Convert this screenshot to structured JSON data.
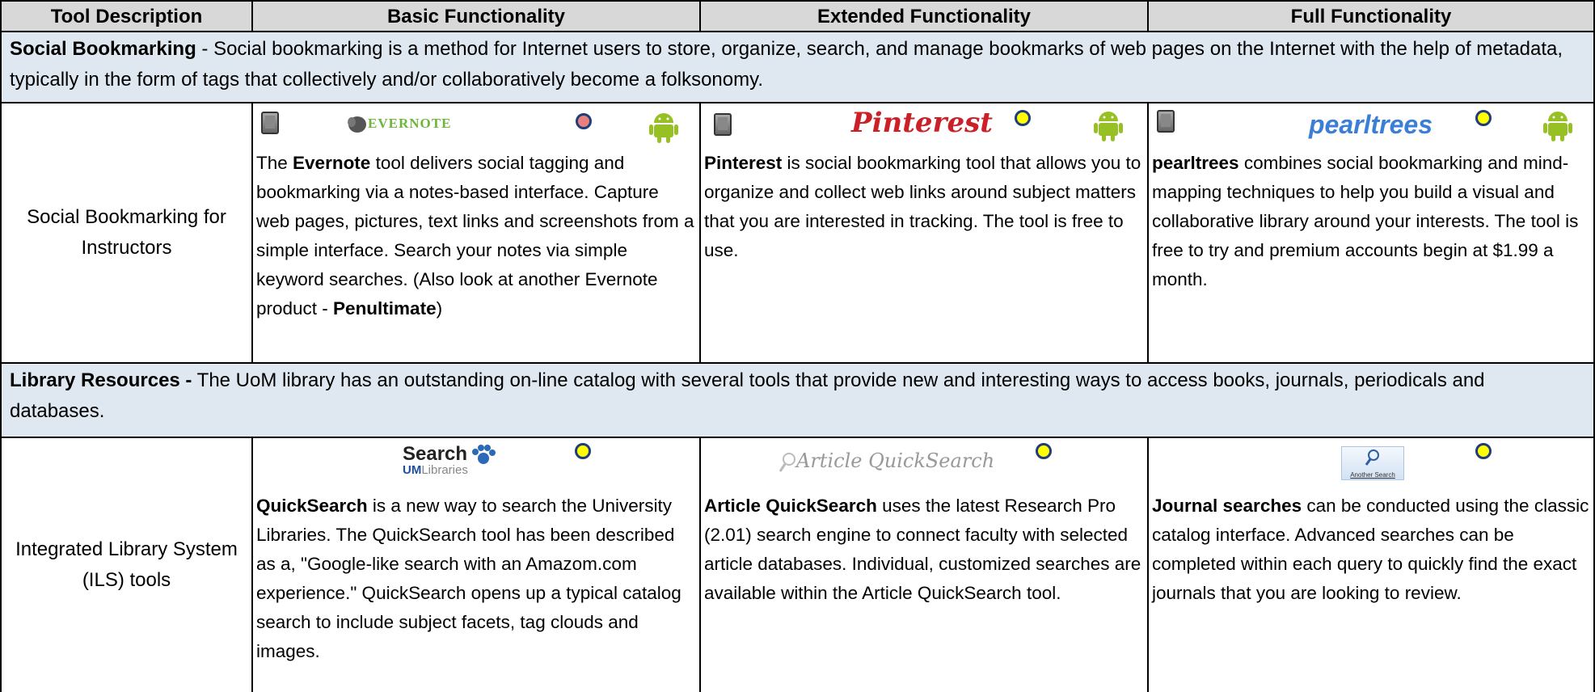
{
  "header": {
    "col1": "Tool Description",
    "col2": "Basic Functionality",
    "col3": "Extended Functionality",
    "col4": "Full Functionality"
  },
  "section1": {
    "title": "Social Bookmarking",
    "text": " - Social bookmarking is a method for Internet users to store, organize, search, and manage bookmarks of web pages on the Internet with the help of metadata, typically in the form of tags that collectively and/or collaboratively become a folksonomy."
  },
  "row1": {
    "label": "Social Bookmarking for Instructors",
    "basic": {
      "logo": "EVERNOTE",
      "pre": "The ",
      "name": "Evernote",
      "body": " tool delivers social tagging and bookmarking via a notes-based interface. Capture web pages, pictures, text links and screenshots from a simple interface.  Search your notes via simple keyword searches. (Also look at another Evernote product - ",
      "product": "Penultimate",
      "post": ")"
    },
    "extended": {
      "logo": "Pinterest",
      "name": "Pinterest",
      "body": " is social bookmarking tool that allows you to organize and collect web links around subject matters that you are interested in tracking.  The tool is free to use."
    },
    "full": {
      "logo": "pearltrees",
      "name": "pearltrees",
      "body": " combines social bookmarking and mind-mapping techniques to help you build a visual and collaborative library around your interests. The tool is free to try and premium accounts begin at $1.99 a month."
    }
  },
  "section2": {
    "title": "Library Resources -",
    "text": " The UoM library has an outstanding  on-line catalog with several tools that provide new and interesting ways to access books, journals, periodicals and databases."
  },
  "row2": {
    "label": "Integrated Library System (ILS) tools",
    "basic": {
      "logo_main": "Search",
      "logo_sub1": "UM",
      "logo_sub2": "Libraries",
      "name": "QuickSearch",
      "body": " is a new way to search the University Libraries.  The QuickSearch tool has been described as a, \"Google-like search with an Amazom.com experience.\" QuickSearch opens up a typical catalog search to include subject facets, tag clouds and images."
    },
    "extended": {
      "logo": "Article QuickSearch",
      "name": "Article QuickSearch",
      "body": " uses the latest Research Pro (2.01) search engine to connect faculty with selected article databases.  Individual, customized searches are available within the Article QuickSearch tool."
    },
    "full": {
      "logo": "Another Search",
      "name": "Journal searches",
      "body": " can be conducted using the classic catalog interface.  Advanced searches can be completed within each query to quickly find the exact journals that you are looking to review."
    }
  },
  "colors": {
    "header_bg": "#d8d8d8",
    "band_bg": "#dfe8f1",
    "dot_yellow": "#ffff00",
    "dot_pink": "#e88080",
    "dot_border": "#1f3d7a",
    "pinterest": "#cb2027",
    "pearltrees": "#3a7fd5"
  },
  "icons": [
    "tablet-icon",
    "status-dot-icon",
    "android-icon",
    "magnifier-icon",
    "paw-icon"
  ]
}
